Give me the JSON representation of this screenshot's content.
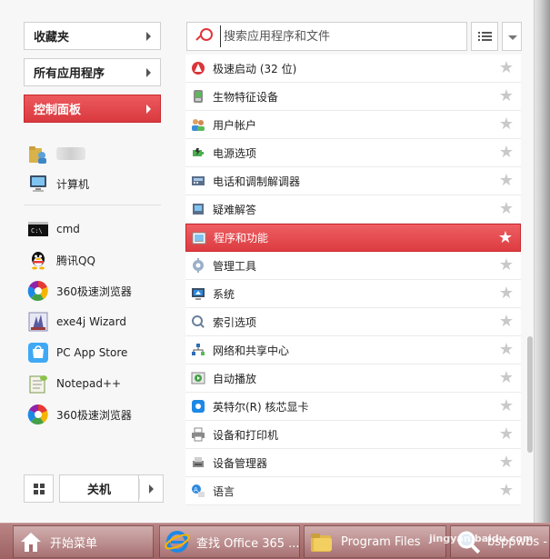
{
  "left": {
    "categories": [
      {
        "label": "收藏夹"
      },
      {
        "label": "所有应用程序"
      },
      {
        "label": "控制面板"
      }
    ],
    "pinned": [
      {
        "label": "计算机",
        "icon": "computer-icon"
      }
    ],
    "recent": [
      {
        "label": "cmd",
        "icon": "cmd-icon"
      },
      {
        "label": "腾讯QQ",
        "icon": "qq-icon"
      },
      {
        "label": "360极速浏览器",
        "icon": "360-browser-icon"
      },
      {
        "label": "exe4j Wizard",
        "icon": "exe4j-icon"
      },
      {
        "label": "PC App Store",
        "icon": "app-store-icon"
      },
      {
        "label": "Notepad++",
        "icon": "notepad-icon"
      },
      {
        "label": "360极速浏览器",
        "icon": "360-browser-icon"
      }
    ],
    "power_label": "关机"
  },
  "search": {
    "placeholder": "搜索应用程序和文件"
  },
  "control_panel_items": [
    {
      "label": "极速启动 (32 位)",
      "icon": "quick-launch-icon"
    },
    {
      "label": "生物特征设备",
      "icon": "biometric-icon"
    },
    {
      "label": "用户帐户",
      "icon": "users-icon"
    },
    {
      "label": "电源选项",
      "icon": "power-options-icon"
    },
    {
      "label": "电话和调制解调器",
      "icon": "phone-modem-icon"
    },
    {
      "label": "疑难解答",
      "icon": "troubleshoot-icon"
    },
    {
      "label": "程序和功能",
      "icon": "programs-icon",
      "highlighted": true
    },
    {
      "label": "管理工具",
      "icon": "admin-tools-icon"
    },
    {
      "label": "系统",
      "icon": "system-icon"
    },
    {
      "label": "索引选项",
      "icon": "index-options-icon"
    },
    {
      "label": "网络和共享中心",
      "icon": "network-icon"
    },
    {
      "label": "自动播放",
      "icon": "autoplay-icon"
    },
    {
      "label": "英特尔(R) 核芯显卡",
      "icon": "intel-graphics-icon"
    },
    {
      "label": "设备和打印机",
      "icon": "printer-icon"
    },
    {
      "label": "设备管理器",
      "icon": "device-manager-icon"
    },
    {
      "label": "语言",
      "icon": "language-icon"
    }
  ],
  "taskbar": {
    "start_label": "开始菜单",
    "tasks": [
      {
        "label": "查找 Office 365 ..."
      },
      {
        "label": "Program Files"
      },
      {
        "label": "bsppwbs - ."
      }
    ],
    "watermark": "jingyan.baidu.com"
  },
  "colors": {
    "accent": "#e0393e",
    "taskbar": "#a86c6d"
  }
}
